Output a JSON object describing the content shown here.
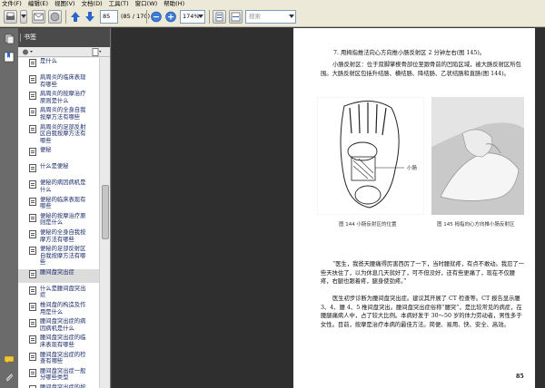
{
  "menu": [
    "文件(F)",
    "编辑(E)",
    "视图(V)",
    "文档(D)",
    "工具(T)",
    "窗口(W)",
    "帮助(H)"
  ],
  "toolbar": {
    "page_number": "85",
    "page_count": "(85 / 170)",
    "zoom": "174%",
    "search_placeholder": "搜索"
  },
  "panel": {
    "title": "书签"
  },
  "bookmarks": [
    {
      "label": "是什么",
      "selected": false
    },
    {
      "label": "肩周炎的临床表现\n有哪些",
      "selected": false
    },
    {
      "label": "肩周炎的按摩治疗\n原则是什么",
      "selected": false
    },
    {
      "label": "肩周炎的全身自我\n按摩方法有哪些",
      "selected": false
    },
    {
      "label": "肩周炎的足部反射\n区自我按摩方法有\n哪些",
      "selected": false
    },
    {
      "label": "便秘",
      "selected": false
    },
    {
      "label": "什么是便秘",
      "selected": false
    },
    {
      "label": "便秘的病因病机是\n什么",
      "selected": false
    },
    {
      "label": "便秘的临床表现有\n哪些",
      "selected": false
    },
    {
      "label": "便秘的按摩治疗原\n则是什么",
      "selected": false
    },
    {
      "label": "便秘的全身自我按\n摩方法有哪些",
      "selected": false
    },
    {
      "label": "便秘的足部反射区\n自我按摩方法有哪\n些",
      "selected": false
    },
    {
      "label": "腰间盘突出症",
      "selected": true
    },
    {
      "label": "什么是腰间盘突出\n症",
      "selected": false
    },
    {
      "label": "椎间盘的构造及作\n用是什么",
      "selected": false
    },
    {
      "label": "腰间盘突出症的病\n因病机是什么",
      "selected": false
    },
    {
      "label": "腰间盘突出症的临\n床表现有哪些",
      "selected": false
    },
    {
      "label": "腰间盘突出症的检\n查有哪些",
      "selected": false
    },
    {
      "label": "腰间盘突出症一般\n分哪些类型",
      "selected": false
    },
    {
      "label": "腰间盘突出症的按",
      "selected": false
    }
  ],
  "document": {
    "heading": "7. 用拇指推法向心方向推小肠反射区 2 分钟左右(图 145)。",
    "para1": "小肠反射区：位于双脚掌楔骨部位至跟骨前的凹陷区域，被大肠反射区所包围。大肠反射区包括升结肠、横结肠、降结肠、乙状结肠和直肠(图 144)。",
    "fig1_label": "小肠",
    "fig1_caption": "图 144   小肠反射区的位置",
    "fig2_caption": "图 145   拇指向心方向推小肠反射区",
    "para2": "“医生，我爸天腰痛得厉害西厉了一下，当时腰就疼，有点不敢动。我忍了一些天扶住了，以为休息几天就好了，可不但没好，还有些更痛了，现在不仅腰疼，右腿也跟着疼，腿身使劲疼。”",
    "para3": "医生初步诊断为腰间盘突出症。建议其开展了 CT 检查等。CT 报告显示腰 3、4、腰 4、5 椎间盘突出。腰间盘突出症俗称“腰突”，是比较常见的病症，在腰腿痛病人中，占了较大比例。本病好发于 30～50 岁的体力劳动者，男性多于女性。目前，按摩是治疗本病的最佳方法。简便、易用、快、安全、高效。",
    "page_number": "85"
  }
}
